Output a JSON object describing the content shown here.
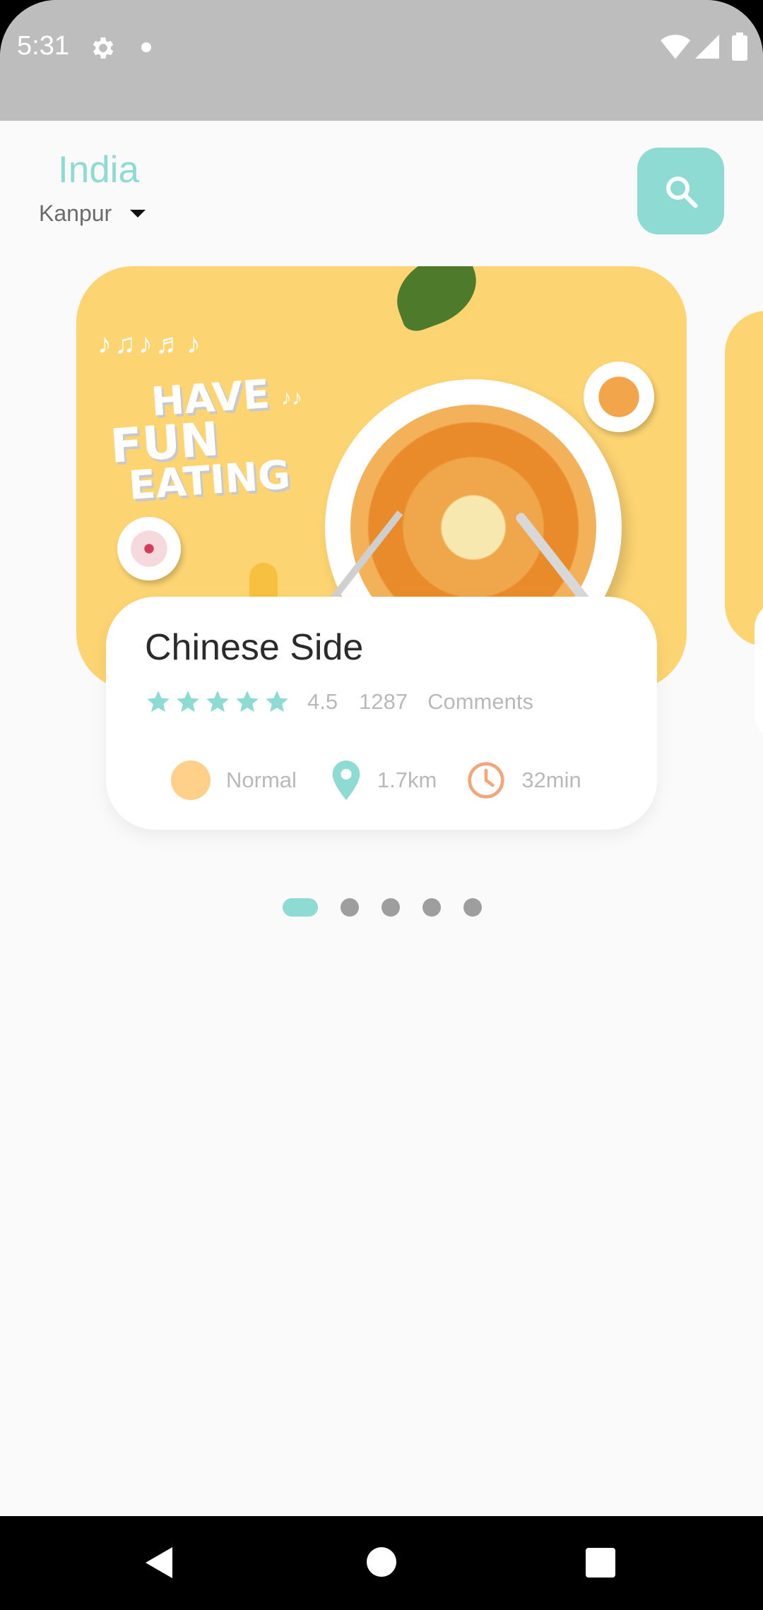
{
  "status_bar": {
    "time": "5:31"
  },
  "location": {
    "country": "India",
    "city": "Kanpur"
  },
  "carousel": {
    "hero_text": [
      "HAVE",
      "FUN",
      "EATING"
    ],
    "active_index": 0,
    "total": 5
  },
  "restaurant": {
    "name": "Chinese Side",
    "stars": 5,
    "rating": "4.5",
    "comments_count": "1287",
    "comments_label": "Comments",
    "level": "Normal",
    "distance": "1.7km",
    "time": "32min"
  },
  "colors": {
    "accent": "#8ddbd2",
    "hero_bg": "#fdd472",
    "level_dot": "#ffd08a",
    "clock": "#f4a57a"
  },
  "icons": [
    "gear-icon",
    "wifi-icon",
    "signal-icon",
    "battery-icon",
    "search-icon",
    "star-icon",
    "pin-icon",
    "clock-icon",
    "back-icon",
    "home-icon",
    "recents-icon"
  ]
}
